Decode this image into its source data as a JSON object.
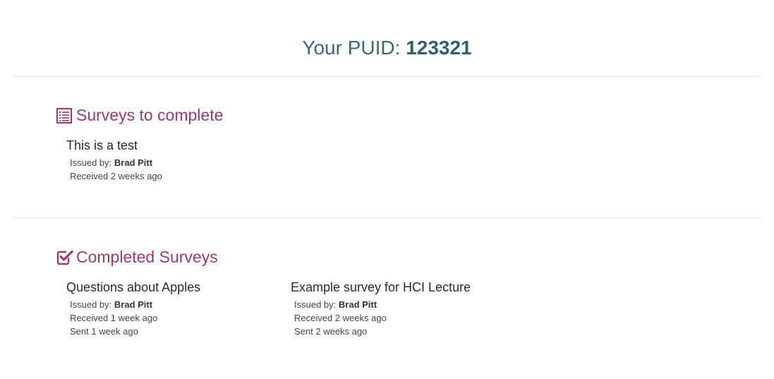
{
  "header": {
    "puid_label": "Your PUID:",
    "puid_value": "123321"
  },
  "to_complete": {
    "title": "Surveys to complete",
    "icon": "list-icon",
    "surveys": [
      {
        "title": "This is a test",
        "issued_label": "Issued by:",
        "issued_by": "Brad Pitt",
        "received": "Received 2 weeks ago"
      }
    ]
  },
  "completed": {
    "title": "Completed Surveys",
    "icon": "check-square-icon",
    "surveys": [
      {
        "title": "Questions about Apples",
        "issued_label": "Issued by:",
        "issued_by": "Brad Pitt",
        "received": "Received 1 week ago",
        "sent": "Sent 1 week ago"
      },
      {
        "title": "Example survey for HCI Lecture",
        "issued_label": "Issued by:",
        "issued_by": "Brad Pitt",
        "received": "Received 2 weeks ago",
        "sent": "Sent 2 weeks ago"
      }
    ]
  },
  "colors": {
    "accent": "#9b3a6c",
    "puid": "#3a6b78"
  }
}
